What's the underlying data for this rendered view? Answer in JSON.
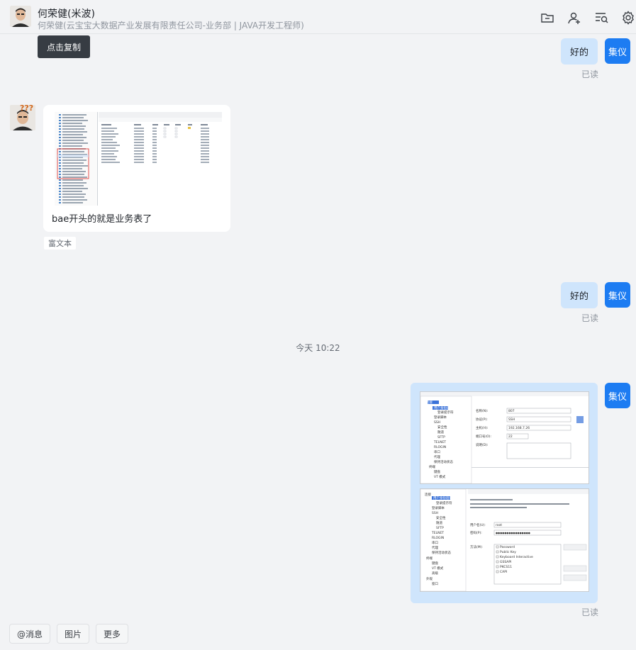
{
  "header": {
    "contact_name": "何荣健(米波)",
    "contact_subtitle": "何荣健(云宝宝大数据产业发展有限责任公司-业务部 | JAVA开发工程师)",
    "icons": [
      "folder-icon",
      "add-member-icon",
      "search-history-icon",
      "settings-icon"
    ]
  },
  "tooltip": {
    "label": "点击复制"
  },
  "me": {
    "avatar_label": "集仪",
    "accent": "#1d7cf2",
    "bubble_color": "#cfe5fc"
  },
  "messages": [
    {
      "from": "me",
      "text": "好的",
      "status": "已读"
    },
    {
      "from": "peer",
      "kind": "rich_text",
      "text": "bae开头的就是业务表了",
      "tag": "富文本"
    },
    {
      "from": "me",
      "text": "好的",
      "status": "已读"
    },
    {
      "from": "me",
      "kind": "image",
      "status": "已读"
    }
  ],
  "time_separator": "今天 10:22",
  "footer": {
    "buttons": [
      "@消息",
      "图片",
      "更多"
    ]
  },
  "screenshot_thumb": {
    "top_panel": {
      "label_name": "名称(N):",
      "value_name": "807",
      "label_protocol": "协议(P):",
      "value_protocol": "SSH",
      "label_host": "主机(H):",
      "value_host": "192.168.7.26",
      "label_port": "端口号(O):",
      "value_port": "22",
      "label_desc": "说明(D):"
    },
    "bottom_panel": {
      "label_user": "用户名(U):",
      "value_user": "root",
      "label_pass": "密码(P):",
      "value_pass": "●●●●●●●●●●●●●●●●",
      "label_method": "方法(M):",
      "methods": [
        "Password",
        "Public Key",
        "Keyboard Interactive",
        "GSSAPI",
        "PKCS11",
        "CAPI"
      ]
    },
    "tree": [
      "连接",
      "用户身份验证",
      "登录提示符",
      "登录脚本",
      "SSH",
      "安全性",
      "隧道",
      "SFTP",
      "TELNET",
      "RLOGIN",
      "串口",
      "代理",
      "保持活动状态",
      "终端",
      "键盘",
      "VT 模式",
      "高级",
      "外观",
      "窗口"
    ]
  }
}
